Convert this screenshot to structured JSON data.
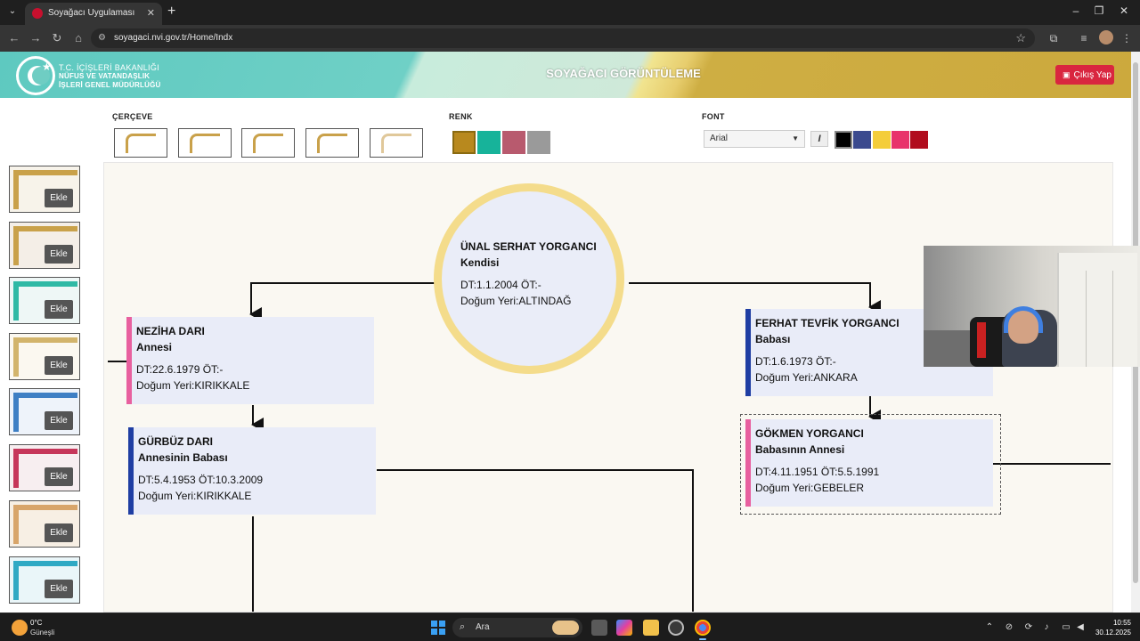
{
  "browser": {
    "tab_title": "Soyağacı Uygulaması - Nüfus ve",
    "url": "soyagaci.nvi.gov.tr/Home/Indx"
  },
  "header": {
    "logo_line1": "T.C. İÇİŞLERİ BAKANLIĞI",
    "logo_line2": "NÜFUS VE VATANDAŞLIK",
    "logo_line3": "İŞLERİ GENEL MÜDÜRLÜĞÜ",
    "title": "SOYAĞACI GÖRÜNTÜLEME",
    "logout_label": "Çıkış Yap"
  },
  "controls": {
    "frame_label": "ÇERÇEVE",
    "color_label": "RENK",
    "font_label": "FONT",
    "font_selected": "Arial",
    "italic_label": "I",
    "colors": [
      "#b8891e",
      "#17b39a",
      "#b85a6e",
      "#9a9a9a"
    ],
    "font_colors": [
      "#000000",
      "#3b4a8e",
      "#f4cd3a",
      "#e8336b",
      "#b10d1e"
    ]
  },
  "templates": {
    "button_label": "Ekle",
    "items": [
      {
        "accent": "#c9a14a",
        "bg": "#f7f3ea"
      },
      {
        "accent": "#c9a14a",
        "bg": "#f4eee7"
      },
      {
        "accent": "#2fb9a5",
        "bg": "#eef7f6"
      },
      {
        "accent": "#d2b46b",
        "bg": "#fbf8f0"
      },
      {
        "accent": "#3e7fc4",
        "bg": "#eef3fa"
      },
      {
        "accent": "#c6365a",
        "bg": "#f7eef0"
      },
      {
        "accent": "#d8a56a",
        "bg": "#f7efe4"
      },
      {
        "accent": "#2fa9c4",
        "bg": "#eaf6f9"
      }
    ]
  },
  "tree": {
    "self": {
      "name": "ÜNAL SERHAT YORGANCI",
      "role": "Kendisi",
      "dates": "DT:1.1.2004 ÖT:-",
      "place": "Doğum Yeri:ALTINDAĞ"
    },
    "mother": {
      "name": "NEZİHA DARI",
      "role": "Annesi",
      "dates": "DT:22.6.1979 ÖT:-",
      "place": "Doğum Yeri:KIRIKKALE",
      "bar_color": "#e8609f"
    },
    "mothers_father": {
      "name": "GÜRBÜZ DARI",
      "role": "Annesinin Babası",
      "dates": "DT:5.4.1953 ÖT:10.3.2009",
      "place": "Doğum Yeri:KIRIKKALE",
      "bar_color": "#1f3ea3"
    },
    "father": {
      "name": "FERHAT TEVFİK YORGANCI",
      "role": "Babası",
      "dates": "DT:1.6.1973 ÖT:-",
      "place": "Doğum Yeri:ANKARA",
      "bar_color": "#1f3ea3"
    },
    "fathers_mother": {
      "name": "GÖKMEN YORGANCI",
      "role": "Babasının Annesi",
      "dates": "DT:4.11.1951 ÖT:5.5.1991",
      "place": "Doğum Yeri:GEBELER",
      "bar_color": "#e8609f"
    }
  },
  "taskbar": {
    "temperature": "0°C",
    "weather": "Güneşli",
    "search_placeholder": "Ara",
    "time": "10:55",
    "date": "30.12.2025"
  }
}
